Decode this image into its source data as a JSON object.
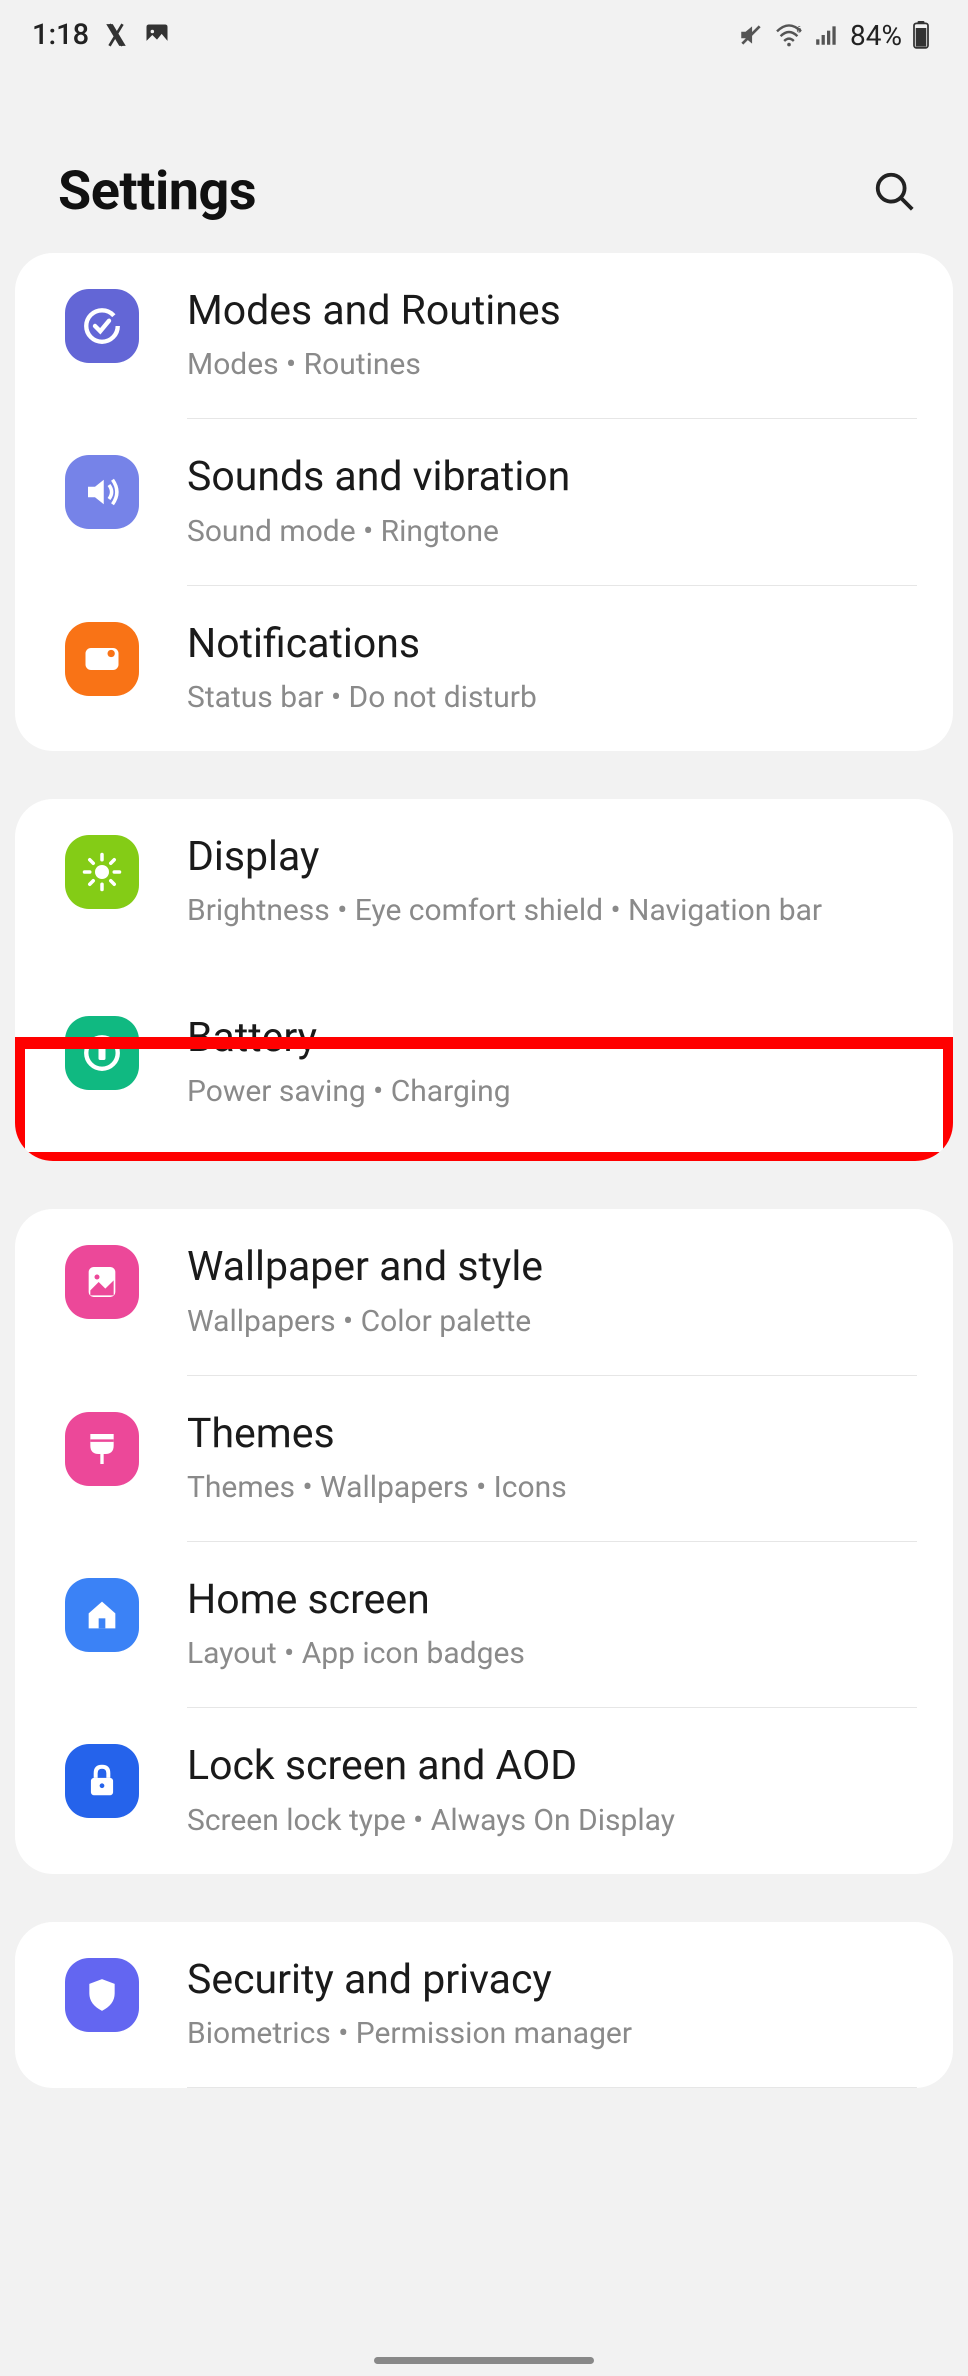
{
  "status": {
    "time": "1:18",
    "battery_pct": "84%"
  },
  "header": {
    "title": "Settings"
  },
  "groups": [
    {
      "items": [
        {
          "title": "Modes and Routines",
          "subtitle": "Modes  •  Routines"
        },
        {
          "title": "Sounds and vibration",
          "subtitle": "Sound mode  •  Ringtone"
        },
        {
          "title": "Notifications",
          "subtitle": "Status bar  •  Do not disturb"
        }
      ]
    },
    {
      "items": [
        {
          "title": "Display",
          "subtitle": "Brightness  •  Eye comfort shield  •  Navigation bar"
        },
        {
          "title": "Battery",
          "subtitle": "Power saving  •  Charging"
        }
      ]
    },
    {
      "items": [
        {
          "title": "Wallpaper and style",
          "subtitle": "Wallpapers  •  Color palette"
        },
        {
          "title": "Themes",
          "subtitle": "Themes  •  Wallpapers  •  Icons"
        },
        {
          "title": "Home screen",
          "subtitle": "Layout  •  App icon badges"
        },
        {
          "title": "Lock screen and AOD",
          "subtitle": "Screen lock type  •  Always On Display"
        }
      ]
    },
    {
      "items": [
        {
          "title": "Security and privacy",
          "subtitle": "Biometrics  •  Permission manager"
        }
      ]
    }
  ],
  "highlight": {
    "target": "battery-item"
  }
}
